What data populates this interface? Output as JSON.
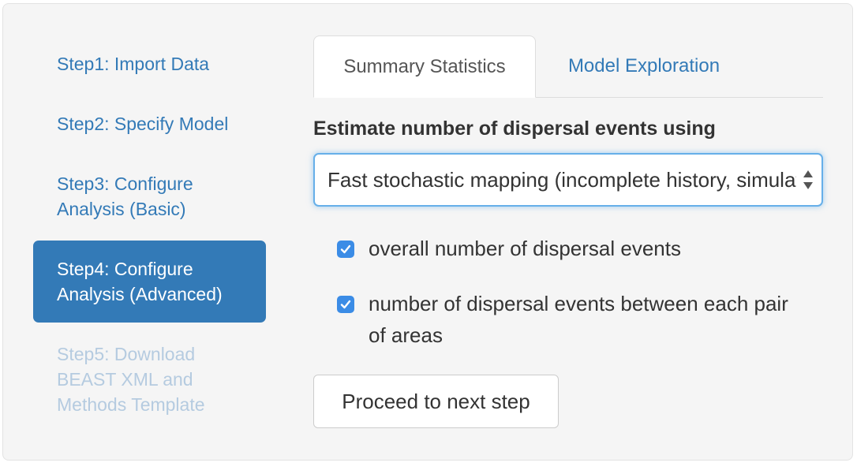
{
  "sidebar": {
    "items": [
      {
        "label": "Step1: Import Data",
        "state": "normal"
      },
      {
        "label": "Step2: Specify Model",
        "state": "normal"
      },
      {
        "label": "Step3: Configure Analysis (Basic)",
        "state": "normal"
      },
      {
        "label": "Step4: Configure Analysis (Advanced)",
        "state": "active"
      },
      {
        "label": "Step5: Download BEAST XML and Methods Template",
        "state": "disabled"
      }
    ]
  },
  "tabs": [
    {
      "label": "Summary Statistics",
      "active": true
    },
    {
      "label": "Model Exploration",
      "active": false
    }
  ],
  "form": {
    "label": "Estimate number of dispersal events using",
    "select_value": "Fast stochastic mapping (incomplete history, simulation-free)",
    "checkboxes": [
      {
        "label": "overall number of dispersal events",
        "checked": true
      },
      {
        "label": "number of dispersal events between each pair of areas",
        "checked": true
      }
    ],
    "proceed_button": "Proceed to next step"
  },
  "colors": {
    "link": "#337ab7",
    "active_bg": "#337ab7",
    "disabled": "#b5cbe0",
    "checkbox": "#3b8ce6",
    "focus_border": "#66afe9"
  }
}
